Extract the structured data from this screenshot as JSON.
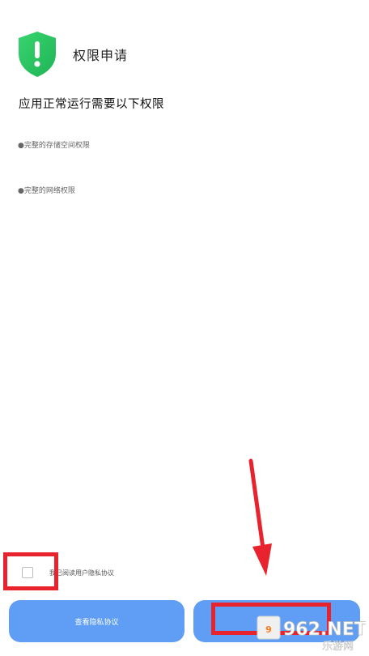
{
  "header": {
    "title": "权限申请",
    "icon": "shield-exclamation-icon",
    "icon_color": "#27c262"
  },
  "subtitle": "应用正常运行需要以下权限",
  "permissions": [
    "●完整的存储空间权限",
    "●完整的网络权限"
  ],
  "agreement": {
    "label": "我已阅读用户隐私协议",
    "checked": false
  },
  "buttons": {
    "privacy_label": "查看隐私协议",
    "agree_label": "",
    "color": "#5f9ef4"
  },
  "annotations": {
    "highlight_color": "#e8232e"
  },
  "watermark": {
    "brand": "962.NET",
    "subtitle": "乐游网"
  }
}
